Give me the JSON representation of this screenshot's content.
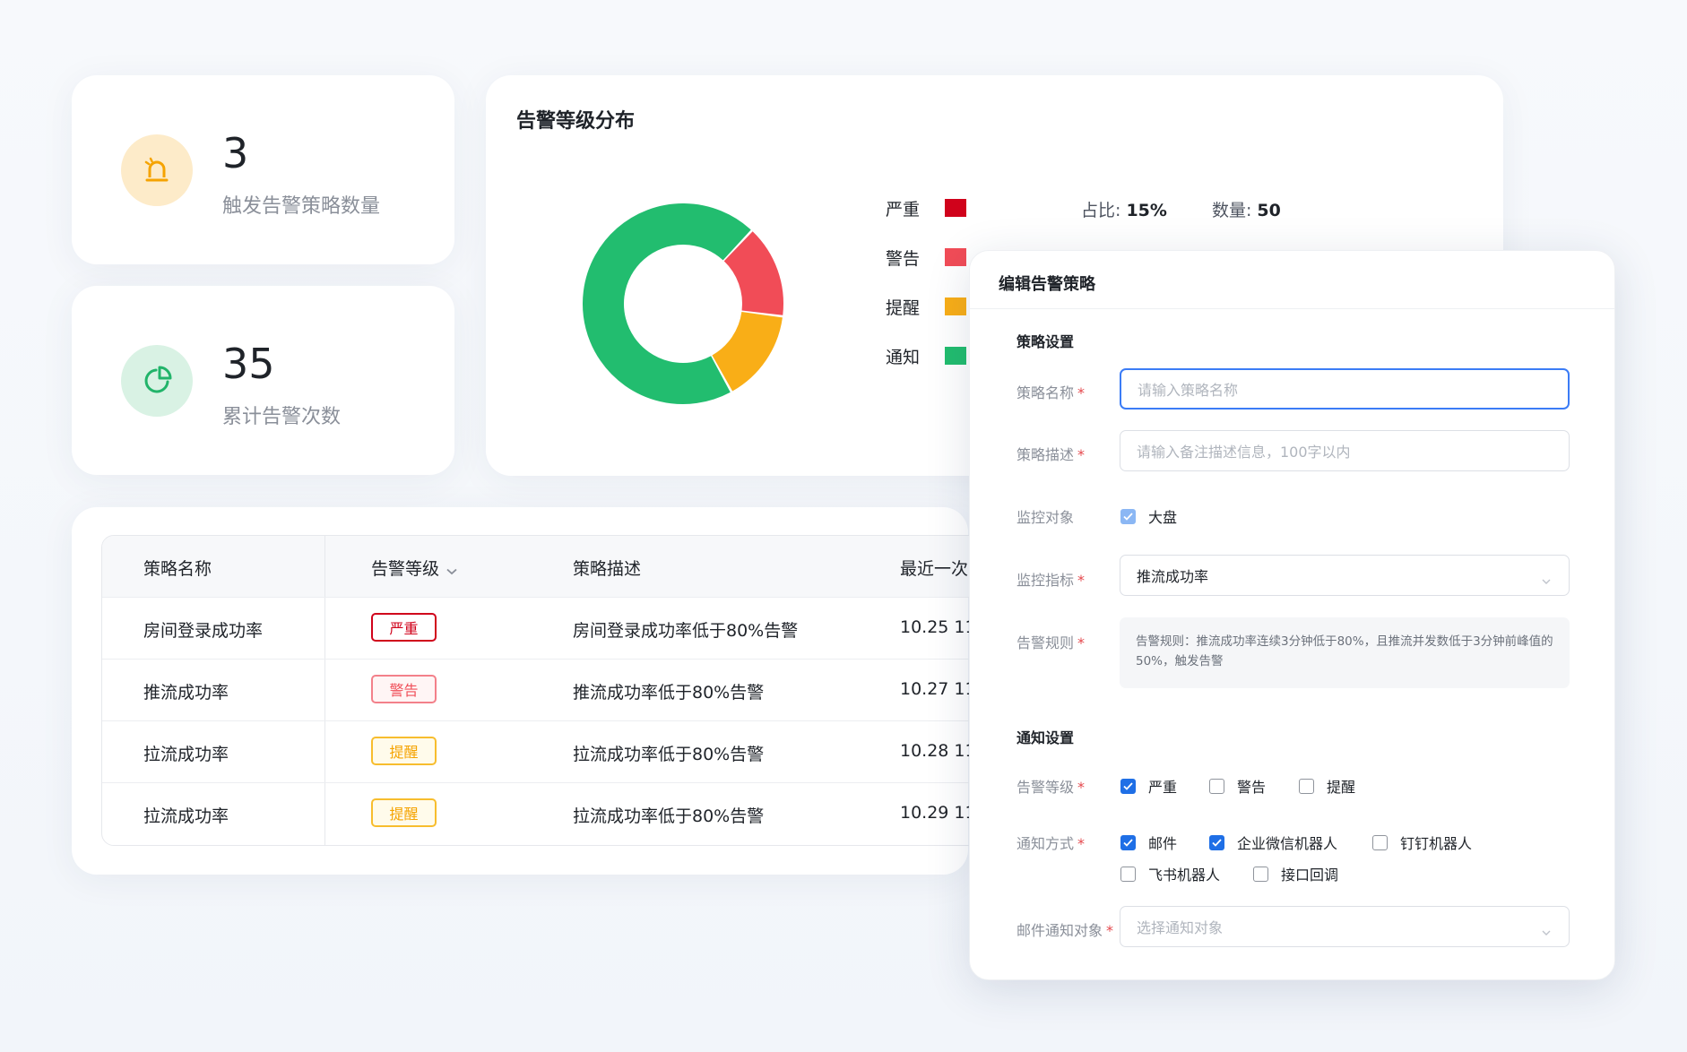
{
  "stats": [
    {
      "value": "3",
      "label": "触发告警策略数量",
      "icon": "alarm-icon"
    },
    {
      "value": "35",
      "label": "累计告警次数",
      "icon": "pie-chart-icon"
    }
  ],
  "chart": {
    "title": "告警等级分布",
    "legend": [
      {
        "name": "严重",
        "color": "#d0021b",
        "ratio_label": "占比:",
        "ratio": "15%",
        "count_label": "数量:",
        "count": "50"
      },
      {
        "name": "警告",
        "color": "#f14c57"
      },
      {
        "name": "提醒",
        "color": "#f9ae17"
      },
      {
        "name": "通知",
        "color": "#22bd6f"
      }
    ]
  },
  "chart_data": {
    "type": "pie",
    "title": "告警等级分布",
    "labels": [
      "严重",
      "警告",
      "提醒",
      "通知"
    ],
    "values": [
      0,
      15,
      15,
      70
    ],
    "colors": [
      "#d0021b",
      "#f14c57",
      "#f9ae17",
      "#22bd6f"
    ]
  },
  "table": {
    "headers": [
      "策略名称",
      "告警等级",
      "策略描述",
      "最近一次"
    ],
    "rows": [
      {
        "name": "房间登录成功率",
        "level": "严重",
        "level_type": "critical",
        "desc": "房间登录成功率低于80%告警",
        "time": "10.25  11"
      },
      {
        "name": "推流成功率",
        "level": "警告",
        "level_type": "warning",
        "desc": "推流成功率低于80%告警",
        "time": "10.27  11"
      },
      {
        "name": "拉流成功率",
        "level": "提醒",
        "level_type": "remind",
        "desc": "拉流成功率低于80%告警",
        "time": "10.28  11"
      },
      {
        "name": "拉流成功率",
        "level": "提醒",
        "level_type": "remind",
        "desc": "拉流成功率低于80%告警",
        "time": "10.29  11"
      }
    ]
  },
  "modal": {
    "title": "编辑告警策略",
    "policy_section": "策略设置",
    "name_label": "策略名称",
    "name_placeholder": "请输入策略名称",
    "desc_label": "策略描述",
    "desc_placeholder": "请输入备注描述信息，100字以内",
    "target_label": "监控对象",
    "target_option": "大盘",
    "metric_label": "监控指标",
    "metric_value": "推流成功率",
    "rule_label": "告警规则",
    "rule_text": "告警规则：推流成功率连续3分钟低于80%，且推流并发数低于3分钟前峰值的50%，触发告警",
    "notify_section": "通知设置",
    "level_label": "告警等级",
    "levels": [
      {
        "label": "严重",
        "checked": true
      },
      {
        "label": "警告",
        "checked": false
      },
      {
        "label": "提醒",
        "checked": false
      }
    ],
    "method_label": "通知方式",
    "methods": [
      {
        "label": "邮件",
        "checked": true
      },
      {
        "label": "企业微信机器人",
        "checked": true
      },
      {
        "label": "钉钉机器人",
        "checked": false
      },
      {
        "label": "飞书机器人",
        "checked": false
      },
      {
        "label": "接口回调",
        "checked": false
      }
    ],
    "mail_target_label": "邮件通知对象",
    "mail_target_placeholder": "选择通知对象",
    "required_mark": "*"
  }
}
